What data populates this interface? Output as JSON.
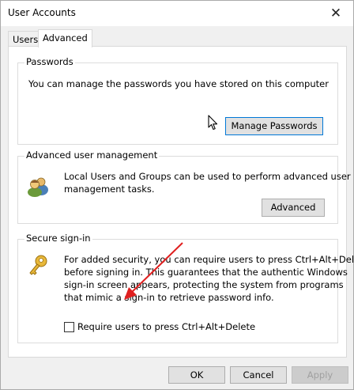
{
  "window": {
    "title": "User Accounts",
    "close_glyph": "✕"
  },
  "tabs": [
    {
      "label": "Users",
      "active": false
    },
    {
      "label": "Advanced",
      "active": true
    }
  ],
  "passwords": {
    "title": "Passwords",
    "description": "You can manage the passwords you have stored on this computer",
    "button_label": "Manage Passwords"
  },
  "advanced_user_management": {
    "title": "Advanced user management",
    "description_line1": "Local Users and Groups can be used to perform advanced user",
    "description_line2": "management tasks.",
    "icon": "users-group-icon",
    "button_label": "Advanced"
  },
  "secure_signin": {
    "title": "Secure sign-in",
    "icon": "key-icon",
    "description_lines": [
      "For added security, you can require users to press Ctrl+Alt+Delete",
      "before signing in. This guarantees that the authentic Windows",
      "sign-in screen appears, protecting the system from programs",
      "that mimic a sign-in to retrieve password info."
    ],
    "checkbox_label": "Require users to press Ctrl+Alt+Delete",
    "checkbox_checked": false
  },
  "footer": {
    "ok_label": "OK",
    "cancel_label": "Cancel",
    "apply_label": "Apply",
    "apply_enabled": false
  },
  "annotation": {
    "arrow_color": "#e02020"
  }
}
